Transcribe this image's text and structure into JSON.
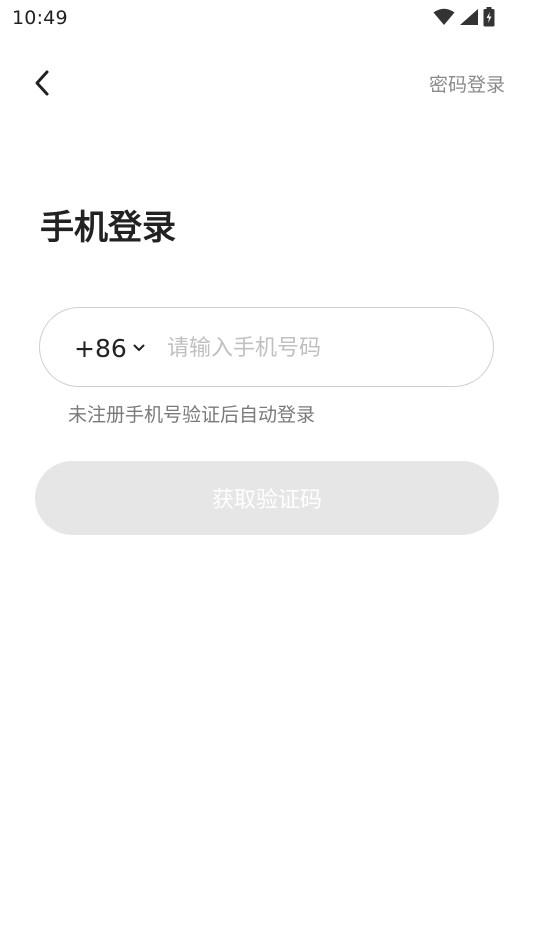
{
  "status_bar": {
    "time": "10:49",
    "icons": [
      "wifi-icon",
      "signal-icon",
      "battery-charging-icon"
    ]
  },
  "nav": {
    "back_icon": "chevron-left-icon",
    "password_login_label": "密码登录"
  },
  "page": {
    "title": "手机登录"
  },
  "phone_field": {
    "country_code": "+86",
    "dropdown_icon": "chevron-down-icon",
    "value": "",
    "placeholder": "请输入手机号码"
  },
  "hint": "未注册手机号验证后自动登录",
  "submit": {
    "label": "获取验证码",
    "enabled": false
  },
  "colors": {
    "text_primary": "#222222",
    "text_secondary": "#8a8a8a",
    "placeholder": "#c0c0c0",
    "input_border": "#cfcfcf",
    "button_disabled_bg": "#e6e6e6",
    "button_text": "#ffffff"
  }
}
